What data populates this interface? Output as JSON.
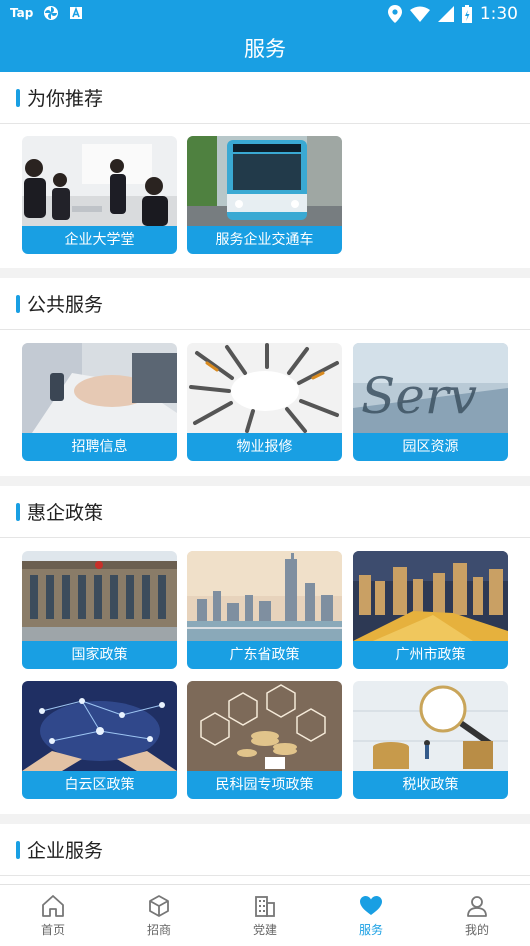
{
  "status_bar": {
    "app_label": "Tap",
    "time": "1:30",
    "icons": [
      "tap-app-icon",
      "pinwheel-icon",
      "a-box-icon",
      "location-icon",
      "wifi-icon",
      "signal-icon",
      "battery-icon"
    ]
  },
  "header": {
    "title": "服务"
  },
  "sections": {
    "recommended": {
      "title": "为你推荐",
      "tiles": [
        {
          "label": "企业大学堂"
        },
        {
          "label": "服务企业交通车"
        }
      ]
    },
    "public": {
      "title": "公共服务",
      "tiles": [
        {
          "label": "招聘信息"
        },
        {
          "label": "物业报修"
        },
        {
          "label": "园区资源"
        }
      ]
    },
    "policy": {
      "title": "惠企政策",
      "tiles": [
        {
          "label": "国家政策"
        },
        {
          "label": "广东省政策"
        },
        {
          "label": "广州市政策"
        },
        {
          "label": "白云区政策"
        },
        {
          "label": "民科园专项政策"
        },
        {
          "label": "税收政策"
        }
      ]
    },
    "enterprise": {
      "title": "企业服务"
    }
  },
  "bottom_nav": {
    "items": [
      {
        "label": "首页",
        "icon": "home-icon"
      },
      {
        "label": "招商",
        "icon": "cube-icon"
      },
      {
        "label": "党建",
        "icon": "building-icon"
      },
      {
        "label": "服务",
        "icon": "heart-icon",
        "active": true
      },
      {
        "label": "我的",
        "icon": "person-icon"
      }
    ]
  },
  "colors": {
    "accent": "#199fe3",
    "background": "#f2f2f2"
  }
}
